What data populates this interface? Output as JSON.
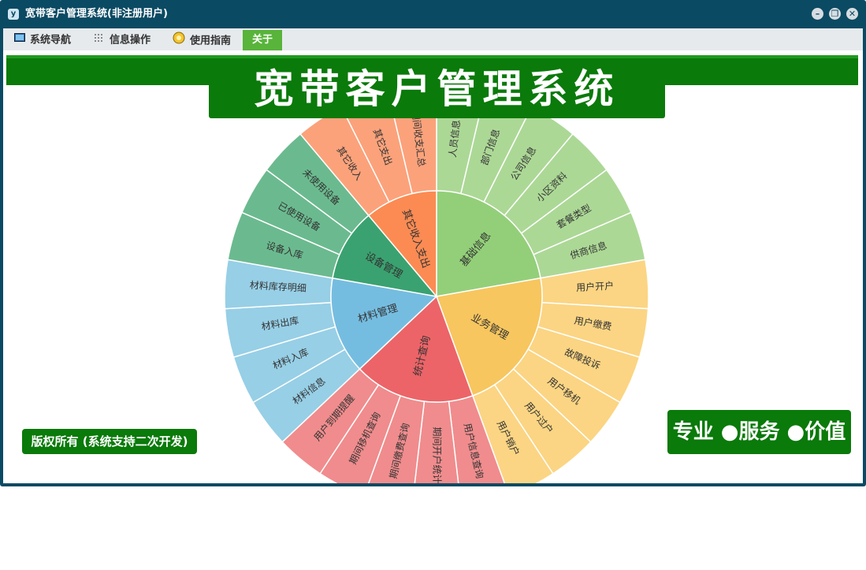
{
  "window": {
    "title": "宽带客户管理系统(非注册用户)",
    "app_icon": "y"
  },
  "menu": [
    {
      "label": "系统导航",
      "icon": "monitor-icon"
    },
    {
      "label": "信息操作",
      "icon": "grid-icon"
    },
    {
      "label": "使用指南",
      "icon": "bulb-icon"
    },
    {
      "label": "关于",
      "icon": ""
    }
  ],
  "banner": {
    "title": "宽带客户管理系统",
    "copyright": "版权所有 (系统支持二次开发)",
    "slogan": "专业 ●服务 ●价值"
  },
  "sunburst": {
    "colors": {
      "base": "#93cf79",
      "biz": "#f7c65e",
      "stat": "#ec6468",
      "mat": "#75bde0",
      "dev": "#3aa270",
      "other": "#fb8b53"
    },
    "sectors": [
      {
        "label": "基础信息",
        "color": "#93cf79",
        "light": "#acd896",
        "children": [
          "人员信息",
          "部门信息",
          "公司信息",
          "小区资料",
          "套餐类型",
          "供商信息"
        ]
      },
      {
        "label": "业务管理",
        "color": "#f7c65e",
        "light": "#fbd583",
        "children": [
          "用户开户",
          "用户缴费",
          "故障投诉",
          "用户移机",
          "用户过户",
          "用户销户"
        ]
      },
      {
        "label": "统计查询",
        "color": "#ec6468",
        "light": "#f08c8d",
        "children": [
          "用户信息查询",
          "期间开户统计",
          "期间缴费查询",
          "期间移机查询",
          "用户到期提醒"
        ]
      },
      {
        "label": "材料管理",
        "color": "#75bde0",
        "light": "#97cfe6",
        "children": [
          "材料信息",
          "材料入库",
          "材料出库",
          "材料库存明细"
        ]
      },
      {
        "label": "设备管理",
        "color": "#3aa270",
        "light": "#6bba8f",
        "children": [
          "设备入库",
          "已使用设备",
          "未使用设备"
        ]
      },
      {
        "label": "其它收入支出",
        "color": "#fb8b53",
        "light": "#fba27b",
        "children": [
          "其它收入",
          "其它支出",
          "期间收支汇总"
        ]
      }
    ]
  }
}
